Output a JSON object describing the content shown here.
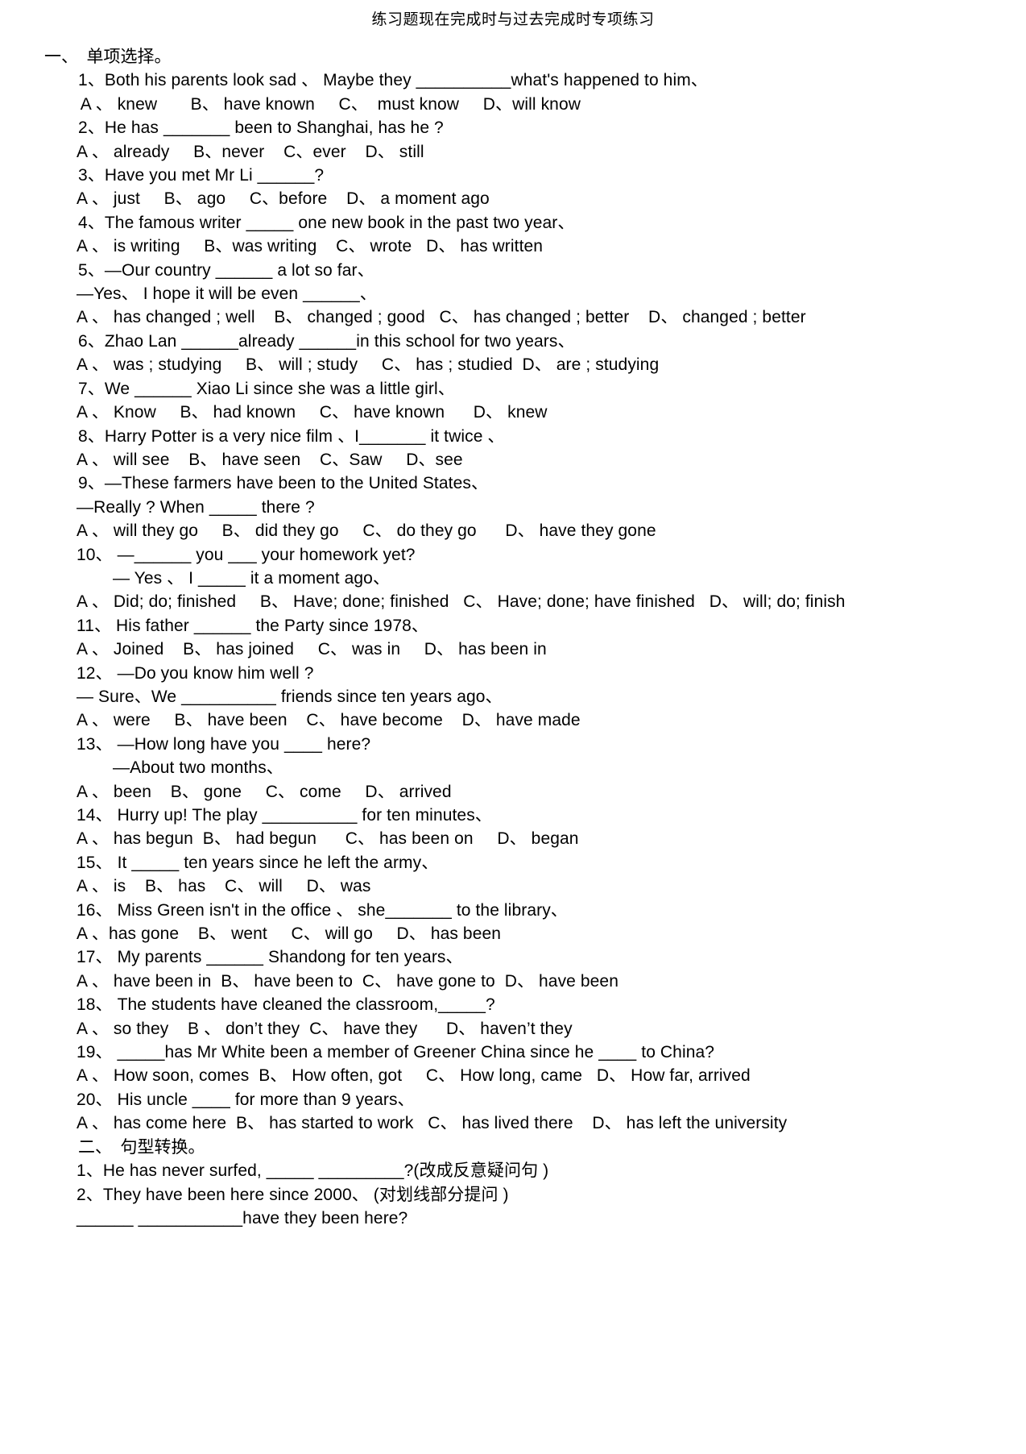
{
  "document": {
    "title": "练习题现在完成时与过去完成时专项练习"
  },
  "sections": [
    {
      "heading": "一、  单项选择。",
      "lines": [
        {
          "indent": "ind-q",
          "text": "1、Both his parents look sad 、 Maybe they __________what's happened to him、"
        },
        {
          "indent": "ind-opt",
          "text": " A 、 knew       B、 have known     C、  must know     D、will know"
        },
        {
          "indent": "ind-q",
          "text": "2、He has _______ been to Shanghai, has he ?"
        },
        {
          "indent": "ind-opt",
          "text": "A 、 already     B、never    C、ever    D、 still"
        },
        {
          "indent": "ind-q",
          "text": "3、Have you met Mr Li ______?"
        },
        {
          "indent": "ind-opt",
          "text": "A 、 just     B、 ago     C、before    D、 a moment ago"
        },
        {
          "indent": "ind-q",
          "text": "4、The famous writer _____ one new book in the past two year、"
        },
        {
          "indent": "ind-opt",
          "text": "A 、 is writing     B、was writing    C、 wrote   D、 has written"
        },
        {
          "indent": "ind-q",
          "text": "5、—Our country ______ a lot so far、"
        },
        {
          "indent": "ind-sub",
          "text": "—Yes、 I hope it will be even ______、"
        },
        {
          "indent": "ind-opt",
          "text": "A 、 has changed ; well    B、 changed ; good   C、 has changed ; better    D、 changed ; better"
        },
        {
          "indent": "ind-q",
          "text": "6、Zhao Lan ______already ______in this school for two years、"
        },
        {
          "indent": "ind-opt",
          "text": "A 、 was ; studying     B、 will ; study     C、 has ; studied  D、 are ; studying"
        },
        {
          "indent": "ind-q",
          "text": "7、We ______ Xiao Li since she was a little girl、"
        },
        {
          "indent": "ind-opt",
          "text": "A 、 Know     B、 had known     C、 have known      D、 knew"
        },
        {
          "indent": "ind-q",
          "text": "8、Harry Potter is a very nice film 、I_______ it twice 、"
        },
        {
          "indent": "ind-opt",
          "text": "A 、 will see    B、 have seen    C、Saw     D、see"
        },
        {
          "indent": "ind-q",
          "text": "9、—These farmers have been to the United States、"
        },
        {
          "indent": "ind-sub",
          "text": "—Really ? When _____ there ?"
        },
        {
          "indent": "ind-opt",
          "text": "A 、 will they go     B、 did they go     C、 do they go      D、 have they gone"
        },
        {
          "indent": "ind-q2",
          "text": "10、 —______ you ___ your homework yet?"
        },
        {
          "indent": "ind-sub2",
          "text": "— Yes 、 I _____ it a moment ago、"
        },
        {
          "indent": "ind-opt",
          "text": "A 、 Did; do; finished     B、 Have; done; finished   C、 Have; done; have finished   D、 will; do; finish"
        },
        {
          "indent": "ind-q2",
          "text": "11、 His father ______ the Party since 1978、"
        },
        {
          "indent": "ind-opt",
          "text": "A 、 Joined    B、 has joined     C、 was in     D、 has been in"
        },
        {
          "indent": "ind-q2",
          "text": "12、 —Do you know him well ?"
        },
        {
          "indent": "ind-sub",
          "text": "— Sure、We __________ friends since ten years ago、"
        },
        {
          "indent": "ind-opt",
          "text": "A 、 were     B、 have been    C、 have become    D、 have made"
        },
        {
          "indent": "ind-q2",
          "text": "13、 —How long have you ____ here?"
        },
        {
          "indent": "ind-sub2",
          "text": "—About two months、"
        },
        {
          "indent": "ind-opt",
          "text": "A 、 been    B、 gone     C、 come     D、 arrived"
        },
        {
          "indent": "ind-q2",
          "text": "14、 Hurry up! The play __________ for ten minutes、"
        },
        {
          "indent": "ind-opt",
          "text": "A 、 has begun  B、 had begun      C、 has been on     D、 began"
        },
        {
          "indent": "ind-q2",
          "text": "15、 It _____ ten years since he left the army、"
        },
        {
          "indent": "ind-opt",
          "text": "A 、 is    B、 has    C、 will     D、 was"
        },
        {
          "indent": "ind-q2",
          "text": "16、 Miss Green isn't in the office 、 she_______ to the library、"
        },
        {
          "indent": "ind-opt",
          "text": "A 、has gone    B、 went     C、 will go     D、 has been"
        },
        {
          "indent": "ind-q2",
          "text": "17、 My parents ______ Shandong for ten years、"
        },
        {
          "indent": "ind-opt",
          "text": "A 、 have been in  B、 have been to  C、 have gone to  D、 have been"
        },
        {
          "indent": "ind-q2",
          "text": "18、 The students have cleaned the classroom,_____?"
        },
        {
          "indent": "ind-opt",
          "text": "A 、 so they    B 、 don’t they  C、 have they      D、 haven’t they"
        },
        {
          "indent": "ind-q2",
          "text": "19、 _____has Mr White been a member of Greener China since he ____ to China?"
        },
        {
          "indent": "ind-opt",
          "text": "A 、 How soon, comes  B、 How often, got     C、 How long, came   D、 How far, arrived"
        },
        {
          "indent": "ind-q2",
          "text": "20、 His uncle ____ for more than 9 years、"
        },
        {
          "indent": "ind-opt",
          "text": "A 、 has come here  B、 has started to work   C、 has lived there    D、 has left the university"
        }
      ]
    },
    {
      "heading": "二、  句型转换。",
      "lines": [
        {
          "indent": "ind-ans",
          "text": "1、He has never surfed, _____ _________?(改成反意疑问句 )"
        },
        {
          "indent": "ind-ans",
          "text": "2、They have been here since 2000、 (对划线部分提问 )"
        },
        {
          "indent": "ind-sub",
          "text": "______ ___________have they been here?"
        }
      ]
    }
  ]
}
